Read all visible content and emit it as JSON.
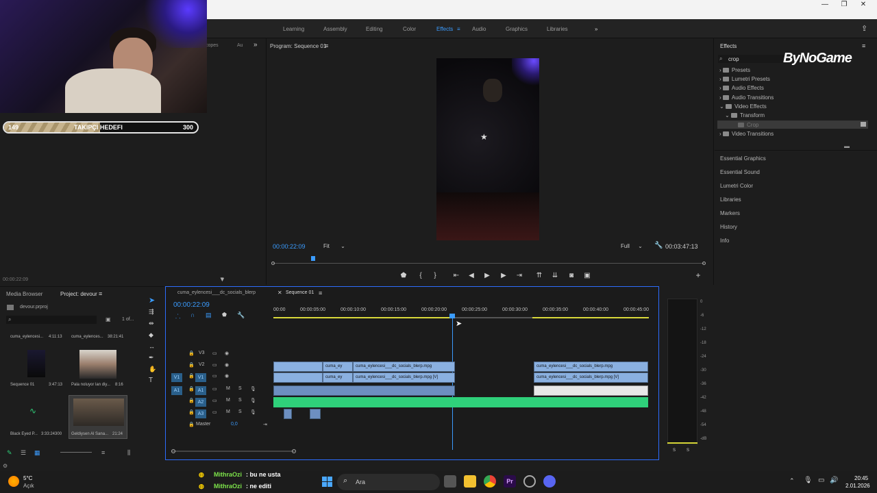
{
  "workspace_tabs": [
    "Learning",
    "Assembly",
    "Editing",
    "Color",
    "Effects",
    "Audio",
    "Graphics",
    "Libraries"
  ],
  "workspace_active": "Effects",
  "window_controls": [
    "—",
    "❐",
    "✕"
  ],
  "webcam_overlay_tabs": [
    "copes",
    "Au"
  ],
  "follower_goal": {
    "current": "149",
    "label": "TAKIPÇI HEDEFI",
    "target": "300",
    "progress": 0.497
  },
  "program_monitor": {
    "title": "Program: Sequence 01",
    "timecode": "00:00:22:09",
    "fit": "Fit",
    "quality": "Full",
    "duration": "00:03:47:13",
    "playhead_position": 0.089
  },
  "left_panel_timecode": "00:00:22:09",
  "effects_panel": {
    "title": "Effects",
    "search": "crop",
    "tree": [
      "Presets",
      "Lumetri Presets",
      "Audio Effects",
      "Audio Transitions",
      "Video Effects",
      "Transform",
      "Crop",
      "Video Transitions"
    ],
    "sections": [
      "Essential Graphics",
      "Essential Sound",
      "Lumetri Color",
      "Libraries",
      "Markers",
      "History",
      "Info"
    ]
  },
  "logo_text": "ByNoGame",
  "project_panel": {
    "tabs": [
      "Media Browser",
      "Project: devour"
    ],
    "file": "devour.prproj",
    "count": "1 of...",
    "items": [
      {
        "name": "cuma_eylencesi...",
        "dur": "4:11:13"
      },
      {
        "name": "cuma_eylences...",
        "dur": "38:21:41"
      },
      {
        "name": "Sequence 01",
        "dur": "3:47:13"
      },
      {
        "name": "Pala noluyor lan diy...",
        "dur": "8:16"
      },
      {
        "name": "Black Eyed P...",
        "dur": "3:33:24300"
      },
      {
        "name": "Geldiysen Al Sana...",
        "dur": "21:24"
      }
    ]
  },
  "timeline": {
    "tabs": [
      "cuma_eylencesi___dc_socials_blerp",
      "Sequence 01"
    ],
    "timecode": "00:00:22:09",
    "ruler": [
      "00:00",
      "00:00:05:00",
      "00:00:10:00",
      "00:00:15:00",
      "00:00:20:00",
      "00:00:25:00",
      "00:00:30:00",
      "00:00:35:00",
      "00:00:40:00",
      "00:00:45:00"
    ],
    "video_tracks": [
      "V3",
      "V2",
      "V1"
    ],
    "audio_tracks": [
      "A1",
      "A2",
      "A3"
    ],
    "master": "Master",
    "master_value": "0,0",
    "clips": {
      "v2_a": "cuma_ey",
      "v2_b": "cuma_eylencesi___dc_socials_blerp.mpg",
      "v1_a": "cuma_ey",
      "v1_b": "cuma_eylencesi___dc_socials_blerp.mpg [V]",
      "v2_c": "cuma_eylencesi___dc_socials_blerp.mpg",
      "v1_c": "cuma_eylencesi___dc_socials_blerp.mpg [V]"
    }
  },
  "meter_db": [
    "0",
    "-6",
    "-12",
    "-18",
    "-24",
    "-30",
    "-36",
    "-42",
    "-48",
    "-54",
    "-dB"
  ],
  "meter_solo": [
    "S",
    "S"
  ],
  "chat": [
    {
      "user": "MithraOzi",
      "msg": ": bu ne usta"
    },
    {
      "user": "MithraOzi",
      "msg": ": ne editi"
    }
  ],
  "weather": {
    "temp": "5°C",
    "desc": "Açık"
  },
  "taskbar_search": "Ara",
  "clock": {
    "time": "20:45",
    "date": "2.01.2026"
  }
}
